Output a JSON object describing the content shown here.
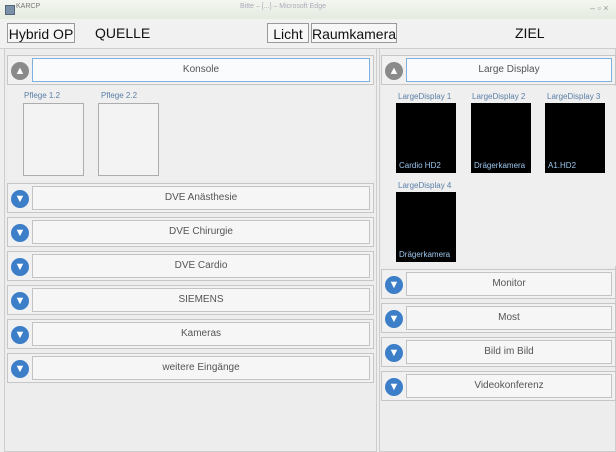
{
  "window": {
    "app_name": "KARCP",
    "title": "Bitte – [...] – Microsoft Edge",
    "controls": "– ▫ ×"
  },
  "topbar": {
    "room_button": "Hybrid OP",
    "source_label": "QUELLE",
    "light_button": "Licht",
    "room_camera_button": "Raumkamera",
    "target_label": "ZIEL"
  },
  "source": {
    "open_section": {
      "label": "Konsole",
      "devices": [
        "Pflege 1.2",
        "Pflege 2.2"
      ]
    },
    "sections": [
      "DVE Anästhesie",
      "DVE Chirurgie",
      "DVE Cardio",
      "SIEMENS",
      "Kameras",
      "weitere Eingänge"
    ]
  },
  "target": {
    "open_section": {
      "label": "Large Display",
      "displays": [
        {
          "name": "LargeDisplay 1",
          "source": "Cardio HD2"
        },
        {
          "name": "LargeDisplay 2",
          "source": "Drägerkamera"
        },
        {
          "name": "LargeDisplay 3",
          "source": "A1.HD2"
        },
        {
          "name": "LargeDisplay 4",
          "source": "Drägerkamera"
        }
      ]
    },
    "sections": [
      "Monitor",
      "Most",
      "Bild im Bild",
      "Videokonferenz"
    ]
  },
  "icons": {
    "expand": "chevron-down-icon",
    "collapse": "chevron-up-icon"
  },
  "colors": {
    "toggle_blue": "#3d7ec8",
    "display_bg": "#000000",
    "source_text": "#9cc6ee"
  }
}
